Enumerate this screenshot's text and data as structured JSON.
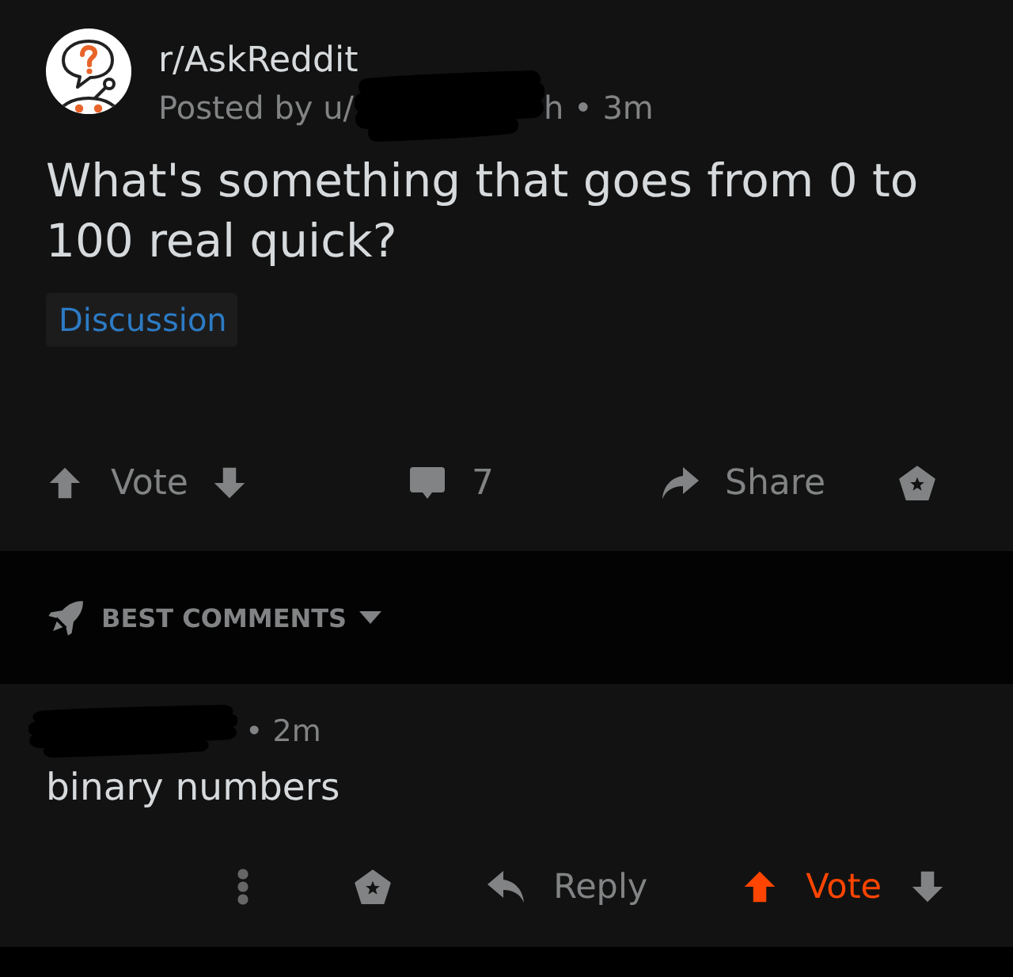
{
  "post": {
    "subreddit": "r/AskReddit",
    "byline": "Posted by u/",
    "author_redacted": true,
    "age": "h • 3m",
    "title": "What's something that goes from 0 to 100 real quick?",
    "flair": "Discussion",
    "upvoted": false,
    "vote_label": "Vote",
    "comment_count": "7",
    "share_label": "Share"
  },
  "sort": {
    "label": "BEST COMMENTS"
  },
  "comments": [
    {
      "author_redacted": true,
      "age": "• 2m",
      "body": "binary numbers",
      "reply_label": "Reply",
      "upvoted": true,
      "vote_label": "Vote"
    }
  ]
}
